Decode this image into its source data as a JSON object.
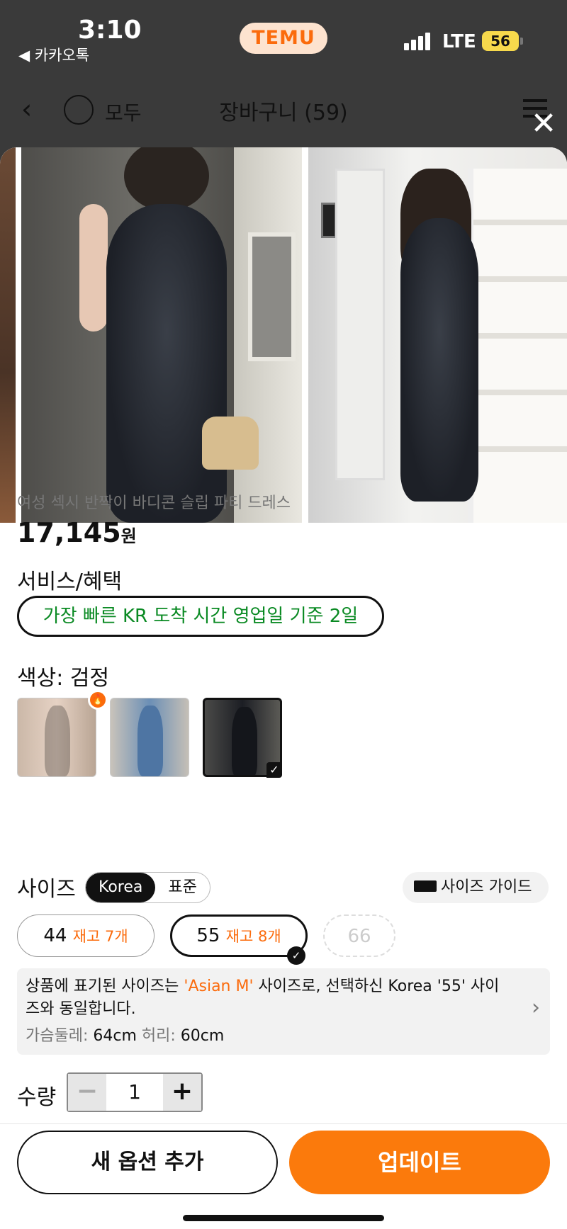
{
  "status_bar": {
    "time": "3:10",
    "back_app": "◀ 카카오톡",
    "app_badge": "TEMU",
    "network": "LTE",
    "battery": "56"
  },
  "nav": {
    "select_all": "모두",
    "title": "장바구니 (59)"
  },
  "product": {
    "name": "여성 섹시 반짝이 바디콘 슬립 파티 드레스",
    "price": "17,145",
    "currency": "원"
  },
  "benefits": {
    "label": "서비스/혜택",
    "badge": "가장 빠른 KR 도착 시간 영업일 기준 2일"
  },
  "color": {
    "label": "색상: 검정",
    "options": [
      "beige-swatch",
      "blue-swatch",
      "black-swatch"
    ],
    "selected_index": 2
  },
  "size": {
    "label": "사이즈",
    "toggle": [
      "Korea",
      "표준"
    ],
    "toggle_active": "Korea",
    "guide": "사이즈 가이드",
    "options": [
      {
        "size": "44",
        "stock": "재고 7개"
      },
      {
        "size": "55",
        "stock": "재고 8개"
      },
      {
        "size": "66",
        "stock": ""
      }
    ],
    "selected": "55"
  },
  "size_info": {
    "text_a": "상품에 표기된 사이즈는 ",
    "highlight": "'Asian M'",
    "text_b": " 사이즈로, 선택하신 Korea '55' 사이즈와 동일합니다.",
    "chest_label": "가슴둘레: ",
    "chest_value": "64cm",
    "waist_label": "허리: ",
    "waist_value": "60cm"
  },
  "quantity": {
    "label": "수량",
    "value": "1",
    "minus": "−",
    "plus": "+"
  },
  "actions": {
    "add_option": "새 옵션 추가",
    "update": "업데이트"
  },
  "colors": {
    "accent": "#fb7a0c",
    "benefit_green": "#0a8a23",
    "temu_orange": "#fb6b0c"
  }
}
